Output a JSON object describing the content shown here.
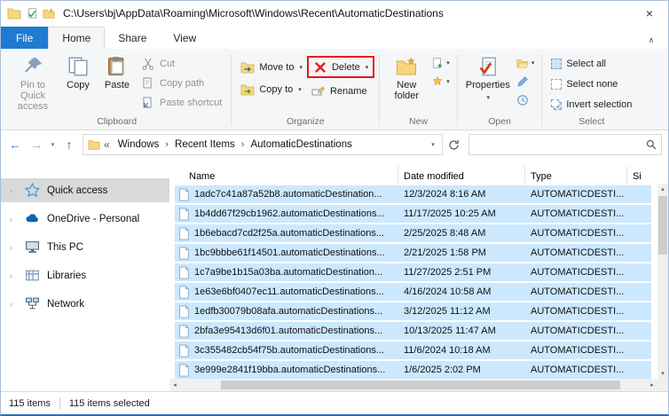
{
  "titlebar": {
    "path": "C:\\Users\\bj\\AppData\\Roaming\\Microsoft\\Windows\\Recent\\AutomaticDestinations"
  },
  "tabs": {
    "file": "File",
    "home": "Home",
    "share": "Share",
    "view": "View"
  },
  "ribbon": {
    "clipboard": {
      "label": "Clipboard",
      "pin": "Pin to Quick access",
      "copy": "Copy",
      "paste": "Paste",
      "cut": "Cut",
      "copy_path": "Copy path",
      "paste_shortcut": "Paste shortcut"
    },
    "organize": {
      "label": "Organize",
      "move_to": "Move to",
      "copy_to": "Copy to",
      "delete": "Delete",
      "rename": "Rename"
    },
    "new_group": {
      "label": "New",
      "new_folder": "New folder"
    },
    "open_group": {
      "label": "Open",
      "properties": "Properties"
    },
    "select_group": {
      "label": "Select",
      "select_all": "Select all",
      "select_none": "Select none",
      "invert_selection": "Invert selection"
    }
  },
  "address": {
    "root_glyph": "«",
    "crumbs": [
      "Windows",
      "Recent Items",
      "AutomaticDestinations"
    ]
  },
  "sidebar": {
    "items": [
      "Quick access",
      "OneDrive - Personal",
      "This PC",
      "Libraries",
      "Network"
    ]
  },
  "list": {
    "columns": {
      "name": "Name",
      "date": "Date modified",
      "type": "Type",
      "size": "Si"
    },
    "rows": [
      {
        "name": "1adc7c41a87a52b8.automaticDestination...",
        "date": "12/3/2024 8:16 AM",
        "type": "AUTOMATICDESTI..."
      },
      {
        "name": "1b4dd67f29cb1962.automaticDestinations...",
        "date": "11/17/2025 10:25 AM",
        "type": "AUTOMATICDESTI..."
      },
      {
        "name": "1b6ebacd7cd2f25a.automaticDestinations...",
        "date": "2/25/2025 8:48 AM",
        "type": "AUTOMATICDESTI..."
      },
      {
        "name": "1bc9bbbe61f14501.automaticDestinations...",
        "date": "2/21/2025 1:58 PM",
        "type": "AUTOMATICDESTI..."
      },
      {
        "name": "1c7a9be1b15a03ba.automaticDestination...",
        "date": "11/27/2025 2:51 PM",
        "type": "AUTOMATICDESTI..."
      },
      {
        "name": "1e63e6bf0407ec11.automaticDestinations...",
        "date": "4/16/2024 10:58 AM",
        "type": "AUTOMATICDESTI..."
      },
      {
        "name": "1edfb30079b08afa.automaticDestinations...",
        "date": "3/12/2025 11:12 AM",
        "type": "AUTOMATICDESTI..."
      },
      {
        "name": "2bfa3e95413d6f01.automaticDestinations...",
        "date": "10/13/2025 11:47 AM",
        "type": "AUTOMATICDESTI..."
      },
      {
        "name": "3c355482cb54f75b.automaticDestinations...",
        "date": "11/6/2024 10:18 AM",
        "type": "AUTOMATICDESTI..."
      },
      {
        "name": "3e999e2841f19bba.automaticDestinations...",
        "date": "1/6/2025 2:02 PM",
        "type": "AUTOMATICDESTI..."
      }
    ]
  },
  "statusbar": {
    "count": "115 items",
    "selected": "115 items selected"
  },
  "glyphs": {
    "close": "×",
    "caret_down": "▾",
    "chevron_right": "›",
    "back": "←",
    "forward": "→",
    "up": "↑",
    "collapse": "∧",
    "scroll_up": "▴",
    "scroll_down": "▾",
    "scroll_left": "◂",
    "scroll_right": "▸"
  },
  "colors": {
    "selection": "#cce8ff",
    "accent_blue": "#1f7ad1",
    "delete_red": "#e8151e"
  }
}
